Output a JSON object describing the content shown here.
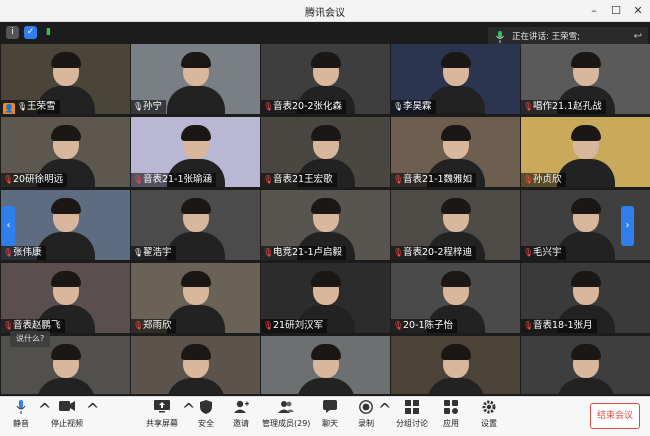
{
  "window": {
    "title": "腾讯会议"
  },
  "speaking": {
    "label": "正在讲话: 王荣雪;"
  },
  "tiles": [
    {
      "name": "王荣雪",
      "muted": false,
      "host": true,
      "bg": "#4a4538"
    },
    {
      "name": "孙宁",
      "muted": false,
      "host": false,
      "bg": "#7a7f86"
    },
    {
      "name": "音表20-2张化森",
      "muted": true,
      "host": false,
      "bg": "#3e3e3e"
    },
    {
      "name": "李昊霖",
      "muted": false,
      "host": false,
      "bg": "#2c3550"
    },
    {
      "name": "唱作21.1赵孔战",
      "muted": true,
      "host": false,
      "bg": "#5a5a5a"
    },
    {
      "name": "20研徐明远",
      "muted": true,
      "host": false,
      "bg": "#5c5850"
    },
    {
      "name": "音表21-1张瑜涵",
      "muted": true,
      "host": false,
      "bg": "#b9b7d4"
    },
    {
      "name": "音表21王宏歌",
      "muted": true,
      "host": false,
      "bg": "#4a4742"
    },
    {
      "name": "音表21-1魏雅如",
      "muted": true,
      "host": false,
      "bg": "#6e5e50"
    },
    {
      "name": "孙贞欣",
      "muted": true,
      "host": false,
      "bg": "#c9aa5a"
    },
    {
      "name": "张伟康",
      "muted": true,
      "host": false,
      "bg": "#5d6c80"
    },
    {
      "name": "翟浩宇",
      "muted": false,
      "host": false,
      "bg": "#4b4b4b"
    },
    {
      "name": "电竞21-1卢启毅",
      "muted": true,
      "host": false,
      "bg": "#585450"
    },
    {
      "name": "音表20-2程梓迪",
      "muted": true,
      "host": false,
      "bg": "#4e4a46"
    },
    {
      "name": "毛兴宇",
      "muted": true,
      "host": false,
      "bg": "#3f3f3f"
    },
    {
      "name": "音表赵鹏飞",
      "muted": true,
      "host": false,
      "bg": "#5a4e4e"
    },
    {
      "name": "郑雨欣",
      "muted": true,
      "host": false,
      "bg": "#6a6256"
    },
    {
      "name": "21研刘汉军",
      "muted": true,
      "host": false,
      "bg": "#2c2c2c"
    },
    {
      "name": "20-1陈子怡",
      "muted": true,
      "host": false,
      "bg": "#4a4a4a"
    },
    {
      "name": "音表18-1张月",
      "muted": true,
      "host": false,
      "bg": "#3a3a3a"
    },
    {
      "name": "",
      "muted": true,
      "host": false,
      "bg": "#52504c"
    },
    {
      "name": "",
      "muted": true,
      "host": false,
      "bg": "#5c544c"
    },
    {
      "name": "",
      "muted": true,
      "host": false,
      "bg": "#6c7070"
    },
    {
      "name": "",
      "muted": true,
      "host": false,
      "bg": "#4c4438"
    },
    {
      "name": "",
      "muted": true,
      "host": false,
      "bg": "#3e3e3e"
    }
  ],
  "tip": "说什么?",
  "toolbar": {
    "mute": "静音",
    "video": "停止视频",
    "share": "共享屏幕",
    "security": "安全",
    "invite": "邀请",
    "members": "管理成员(29)",
    "chat": "聊天",
    "record": "录制",
    "breakout": "分组讨论",
    "apps": "应用",
    "settings": "设置",
    "end": "结束会议"
  },
  "colors": {
    "accent": "#2f80ed",
    "host_badge": "#f08a24",
    "active_border": "#2aa845",
    "end": "#e24b4b"
  }
}
